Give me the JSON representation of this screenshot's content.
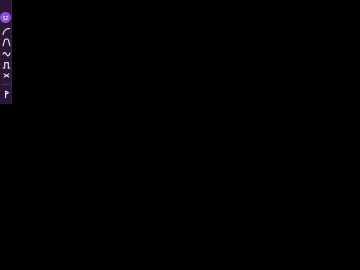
{
  "toolbar": {
    "tools": [
      {
        "name": "smile-icon"
      },
      {
        "name": "curve-tool-icon"
      },
      {
        "name": "arc-tool-icon"
      },
      {
        "name": "wave-tool-icon"
      },
      {
        "name": "steps-tool-icon"
      },
      {
        "name": "cross-tool-icon"
      },
      {
        "name": "flag-tool-icon"
      }
    ],
    "accent_color": "#8d4fdc",
    "background_color": "#2a1736"
  }
}
